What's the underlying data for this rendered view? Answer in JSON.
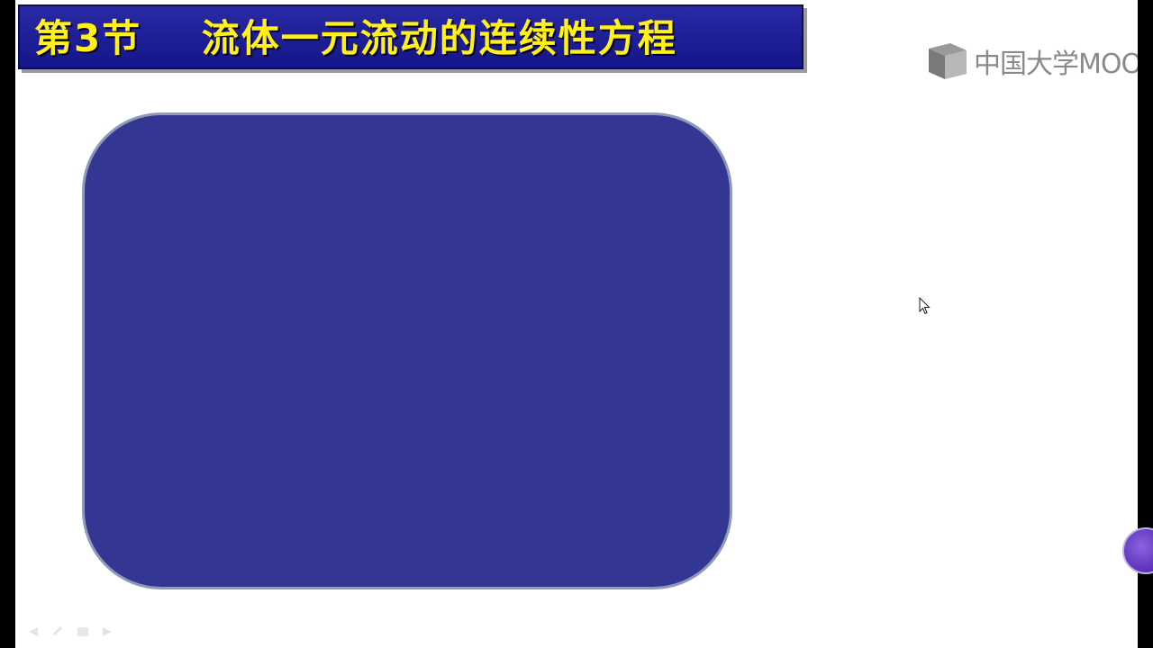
{
  "slide": {
    "title": "第3节    流体一元流动的连续性方程"
  },
  "watermark": {
    "text": "中国大学MOOC",
    "icon": "mooc-logo-icon"
  },
  "colors": {
    "title_bar": "#1f1f9a",
    "title_text": "#ffef1a",
    "content_box": "#343694",
    "content_box_border": "#8f9ab8"
  },
  "icons": [
    "mooc-logo-icon",
    "mouse-pointer-icon",
    "slide-nav-previous-icon",
    "slide-nav-pen-icon",
    "slide-nav-menu-icon",
    "slide-nav-next-icon"
  ]
}
